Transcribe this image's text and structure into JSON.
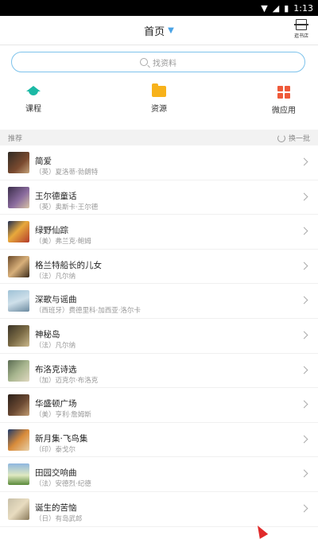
{
  "status_bar": {
    "time": "1:13",
    "icons": [
      "wifi-icon",
      "signal-icon",
      "battery-icon"
    ]
  },
  "header": {
    "title": "首页",
    "dropdown_icon": "chevron-down-icon",
    "scan_icon": "scan-icon",
    "scan_label": "逛书店"
  },
  "search": {
    "placeholder": "找资料",
    "icon": "search-icon"
  },
  "quick_links": [
    {
      "label": "课程",
      "icon": "graduation-cap-icon",
      "color": "#1bb9a5"
    },
    {
      "label": "资源",
      "icon": "folder-icon",
      "color": "#f7b21b"
    },
    {
      "label": "微应用",
      "icon": "apps-grid-icon",
      "color": "#ef5a3a"
    }
  ],
  "section": {
    "title": "推荐",
    "refresh_label": "换一批"
  },
  "books": [
    {
      "title": "简爱",
      "author": "（英）夏洛蒂·勃朗特"
    },
    {
      "title": "王尔德童话",
      "author": "（英）奥斯卡·王尔德"
    },
    {
      "title": "绿野仙踪",
      "author": "（美）弗兰克·鲍姆"
    },
    {
      "title": "格兰特船长的儿女",
      "author": "（法）凡尔纳"
    },
    {
      "title": "深歌与谣曲",
      "author": "（西班牙）费德里科·加西亚·洛尔卡"
    },
    {
      "title": "神秘岛",
      "author": "（法）凡尔纳"
    },
    {
      "title": "布洛克诗选",
      "author": "（加）迈克尔·布洛克"
    },
    {
      "title": "华盛顿广场",
      "author": "（美）亨利·詹姆斯"
    },
    {
      "title": "新月集·飞鸟集",
      "author": "（印）泰戈尔"
    },
    {
      "title": "田园交响曲",
      "author": "（法）安德烈·纪德"
    },
    {
      "title": "诞生的苦恼",
      "author": "（日）有岛武郎"
    }
  ]
}
